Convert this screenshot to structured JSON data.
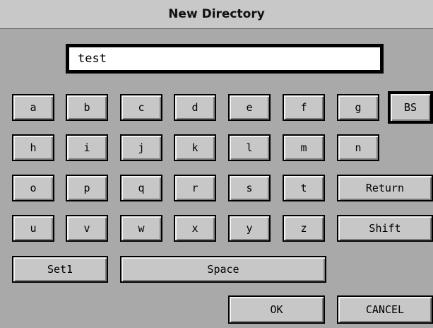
{
  "dialog": {
    "title": "New Directory",
    "input_value": "test"
  },
  "keys": {
    "a": "a",
    "b": "b",
    "c": "c",
    "d": "d",
    "e": "e",
    "f": "f",
    "g": "g",
    "h": "h",
    "i": "i",
    "j": "j",
    "k": "k",
    "l": "l",
    "m": "m",
    "n": "n",
    "o": "o",
    "p": "p",
    "q": "q",
    "r": "r",
    "s": "s",
    "t": "t",
    "u": "u",
    "v": "v",
    "w": "w",
    "x": "x",
    "y": "y",
    "z": "z",
    "bs": "BS",
    "return": "Return",
    "shift": "Shift",
    "set1": "Set1",
    "space": "Space"
  },
  "footer": {
    "ok": "OK",
    "cancel": "CANCEL"
  }
}
